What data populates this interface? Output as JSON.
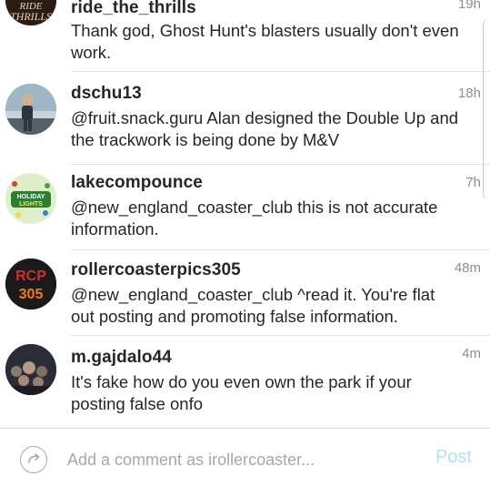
{
  "comments": [
    {
      "username": "ride_the_thrills",
      "text": "Thank god, Ghost Hunt's blasters usually don't even work.",
      "time": "19h",
      "avatar_icon": "ride-the-thrills-logo",
      "avatar_text": "RIDE\nTHRILLS"
    },
    {
      "username": "dschu13",
      "text": "@fruit.snack.guru Alan designed the Double Up and the trackwork is being done by M&V",
      "time": "18h",
      "avatar_icon": "person-photo"
    },
    {
      "username": "lakecompounce",
      "text": "@new_england_coaster_club this is not accurate information.",
      "time": "7h",
      "avatar_icon": "holiday-lights-logo",
      "avatar_text": "HOLIDAY\nLIGHTS"
    },
    {
      "username": "rollercoasterpics305",
      "text": "@new_england_coaster_club ^read it. You're flat out posting and promoting false information.",
      "time": "48m",
      "avatar_icon": "rcp-305-logo",
      "avatar_text_top": "RCP",
      "avatar_text_bottom": "305"
    },
    {
      "username": "m.gajdalo44",
      "text": "It's fake how do you even own the park if your posting false onfo",
      "time": "4m",
      "avatar_icon": "crowd-photo"
    }
  ],
  "composer": {
    "placeholder": "Add a comment as irollercoaster...",
    "post_label": "Post"
  },
  "colors": {
    "username": "#262626",
    "time": "#8e8e8e",
    "post_disabled": "#b2dffc",
    "rcp_red": "#d32f2f",
    "rcp_orange": "#f57c00"
  }
}
